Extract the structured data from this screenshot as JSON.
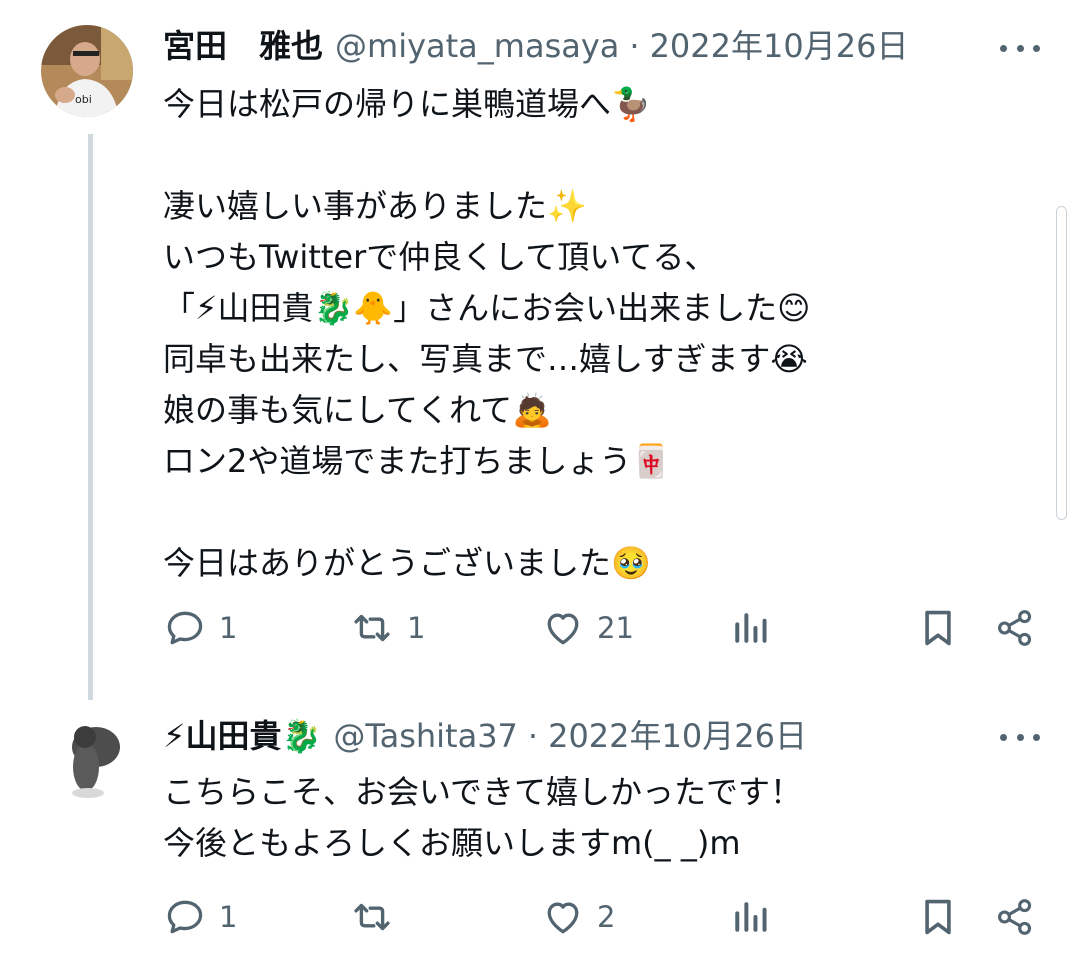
{
  "tweets": [
    {
      "author_name": "宮田　雅也",
      "handle": "@miyata_masaya",
      "separator": "·",
      "date": "2022年10月26日",
      "lines": [
        "今日は松戸の帰りに巣鴨道場へ🦆",
        "",
        "凄い嬉しい事がありました✨",
        "いつもTwitterで仲良くして頂いてる、",
        "「⚡山田貴🐉🐥」さんにお会い出来ました😊",
        "同卓も出来たし、写真まで…嬉しすぎます😭",
        "娘の事も気にしてくれて🙇",
        "ロン2や道場でまた打ちましょう🀄",
        "",
        "今日はありがとうございました🥹"
      ],
      "replies": "1",
      "retweets": "1",
      "likes": "21"
    },
    {
      "author_name": "⚡山田貴🐉",
      "handle": "@Tashita37",
      "separator": "·",
      "date": "2022年10月26日",
      "lines": [
        "こちらこそ、お会いできて嬉しかったです！",
        "今後ともよろしくお願いしますm(_ _)m"
      ],
      "replies": "1",
      "retweets": "",
      "likes": "2"
    }
  ],
  "icons": {
    "reply": "speech-bubble-icon",
    "retweet": "retweet-arrows-icon",
    "like": "heart-icon",
    "views": "bar-chart-icon",
    "bookmark": "bookmark-icon",
    "share": "share-icon",
    "more": "more-dots-icon"
  },
  "colors": {
    "text": "#0f1419",
    "secondary": "#536471",
    "thread_line": "#cfd9de"
  }
}
